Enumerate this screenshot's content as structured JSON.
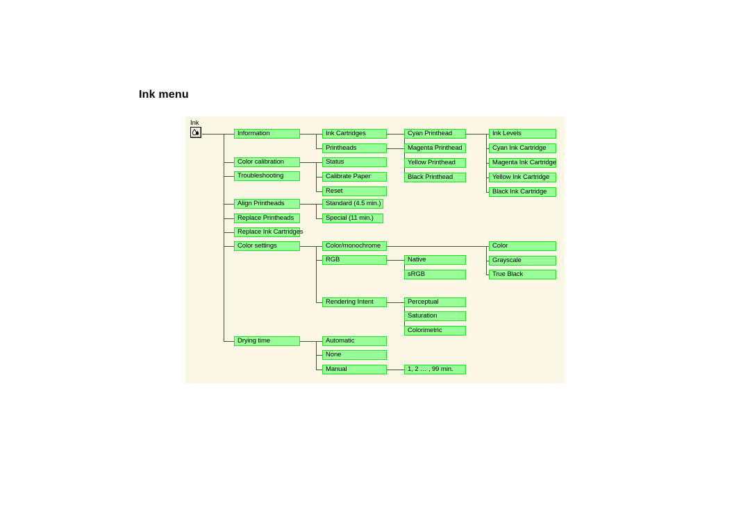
{
  "page": {
    "title": "Ink menu",
    "background_color": "#ffffff",
    "canvas_color": "#faf7e4",
    "node_fill_color": "#99ff99",
    "node_border_color": "#22dd22",
    "line_color": "#4a4a3a"
  },
  "root": {
    "label": "Ink",
    "icon": "ink-drop-icon"
  },
  "nodes": {
    "information": "Information",
    "color_calibration": "Color calibration",
    "troubleshooting": "Troubleshooting",
    "align_printheads": "Align Printheads",
    "replace_printheads": "Replace Printheads",
    "replace_ink_cartridges": "Replace Ink Cartridges",
    "color_settings": "Color settings",
    "drying_time": "Drying time",
    "ink_cartridges": "Ink Cartridges",
    "printheads": "Printheads",
    "status": "Status",
    "calibrate_paper": "Calibrate Paper",
    "reset": "Reset",
    "standard": "Standard (4.5 min.)",
    "special": "Special (11 min.)",
    "color_monochrome": "Color/monochrome",
    "rgb": "RGB",
    "rendering_intent": "Rendering Intent",
    "automatic": "Automatic",
    "none": "None",
    "manual": "Manual",
    "cyan_printhead": "Cyan Printhead",
    "magenta_printhead": "Magenta Printhead",
    "yellow_printhead": "Yellow Printhead",
    "black_printhead": "Black Printhead",
    "native": "Native",
    "srgb": "sRGB",
    "perceptual": "Perceptual",
    "saturation": "Saturation",
    "colorimetric": "Colorimetric",
    "manual_range": "1, 2 …  , 99 min.",
    "ink_levels": "Ink Levels",
    "cyan_ink_cartridge": "Cyan Ink Cartridge",
    "magenta_ink_cartridge": "Magenta Ink Cartridge",
    "yellow_ink_cartridge": "Yellow Ink Cartridge",
    "black_ink_cartridge": "Black Ink Cartridge",
    "color": "Color",
    "grayscale": "Grayscale",
    "true_black": "True Black"
  }
}
